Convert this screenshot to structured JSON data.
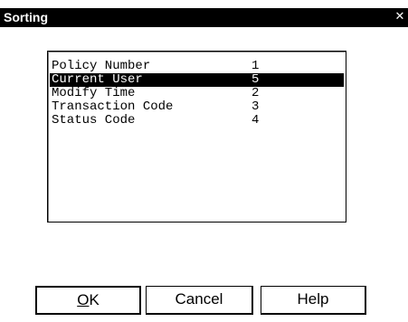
{
  "dialog": {
    "title": "Sorting",
    "close_glyph": "✕"
  },
  "sort_list": {
    "items": [
      {
        "label": "Policy Number",
        "order": "1",
        "selected": false
      },
      {
        "label": "Current User",
        "order": "5",
        "selected": true
      },
      {
        "label": "Modify Time",
        "order": "2",
        "selected": false
      },
      {
        "label": "Transaction Code",
        "order": "3",
        "selected": false
      },
      {
        "label": "Status Code",
        "order": "4",
        "selected": false
      }
    ]
  },
  "buttons": {
    "ok_mnemonic": "O",
    "ok_rest": "K",
    "cancel_label": "Cancel",
    "help_label": "Help"
  },
  "colors": {
    "titlebar_bg": "#000000",
    "selection_bg": "#000000",
    "window_bg": "#ffffff"
  }
}
